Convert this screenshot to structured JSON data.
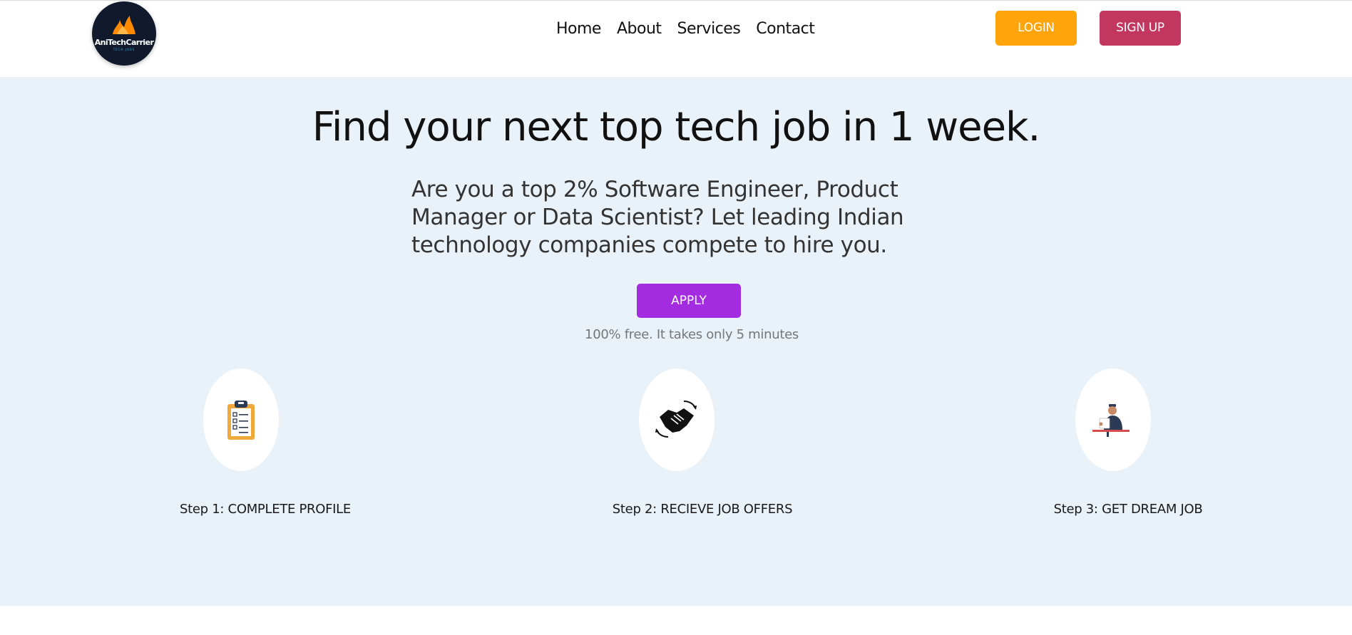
{
  "brand": {
    "name": "AniTechCarrier",
    "tagline": "TECH JOBS",
    "colors": {
      "logo_bg": "#101a2c",
      "flame": "#ff8a00"
    }
  },
  "nav": {
    "links": [
      "Home",
      "About",
      "Services",
      "Contact"
    ],
    "login_label": "LOGIN",
    "signup_label": "SIGN UP"
  },
  "hero": {
    "title": "Find your next top tech job in 1 week.",
    "subtitle": "Are you a top 2% Software Engineer, Product Manager or Data Scientist? Let leading Indian technology companies compete to hire you.",
    "apply_label": "APPLY",
    "note": "100% free. It takes only 5 minutes",
    "background": "#e9f1f9"
  },
  "steps": [
    {
      "label": "Step 1: COMPLETE PROFILE",
      "icon": "clipboard-icon"
    },
    {
      "label": "Step 2: RECIEVE JOB OFFERS",
      "icon": "handshake-icon"
    },
    {
      "label": "Step 3: GET DREAM JOB",
      "icon": "person-at-desk-icon"
    }
  ],
  "colors": {
    "login": "#ffa40a",
    "signup": "#c2375f",
    "apply": "#a42ce0"
  }
}
